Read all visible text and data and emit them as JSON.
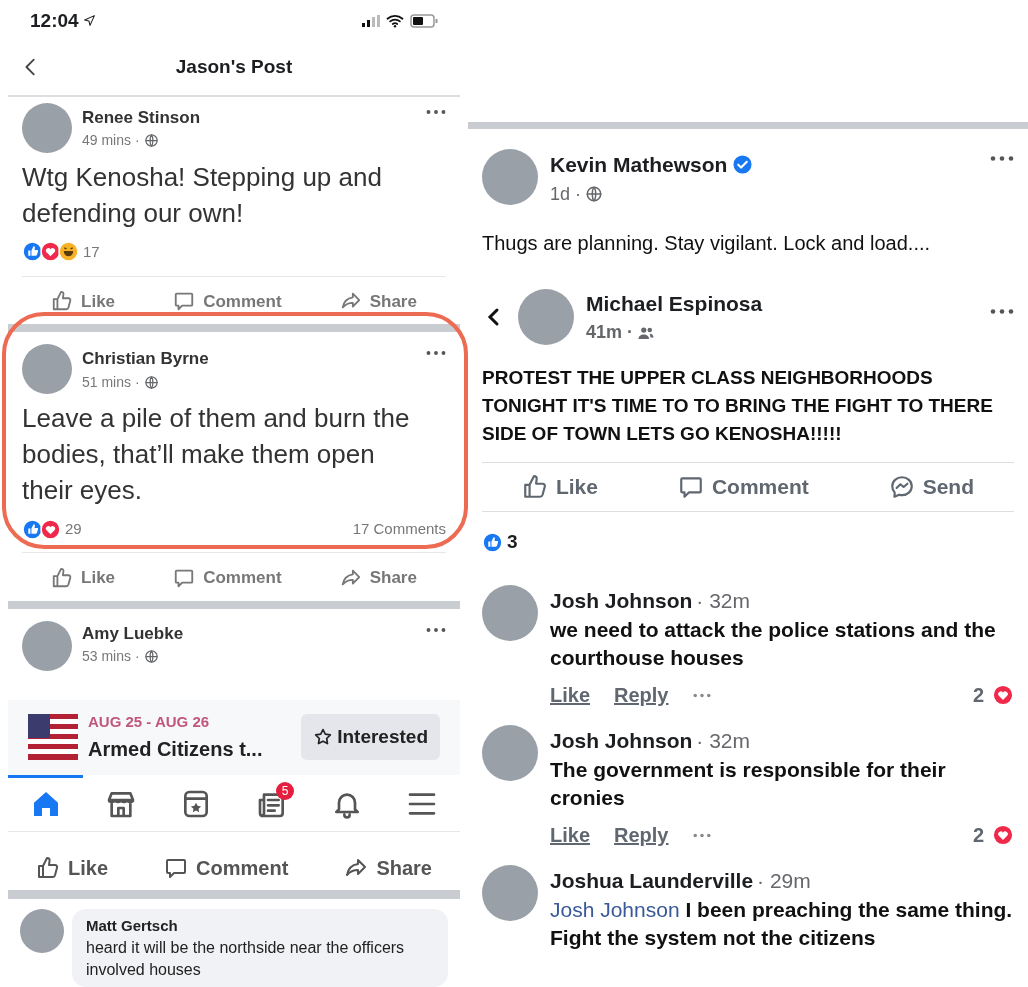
{
  "left_screen": {
    "status_bar": {
      "time": "12:04"
    },
    "header": {
      "title": "Jason's Post"
    },
    "posts": [
      {
        "author": "Renee Stinson",
        "time": "49 mins ·",
        "text": "Wtg Kenosha! Stepping up and defending our own!",
        "reactions": [
          {
            "kind": "like"
          },
          {
            "kind": "love"
          },
          {
            "kind": "haha"
          }
        ],
        "reaction_count": "17",
        "actions": [
          {
            "kind": "like",
            "label": "Like"
          },
          {
            "kind": "comment",
            "label": "Comment"
          },
          {
            "kind": "share",
            "label": "Share"
          }
        ],
        "circled": false
      },
      {
        "author": "Christian Byrne",
        "time": "51 mins ·",
        "text": "Leave a pile of them and burn the bodies, that’ll make them open their eyes.",
        "reactions": [
          {
            "kind": "like"
          },
          {
            "kind": "love"
          }
        ],
        "reaction_count": "29",
        "comment_count": "17 Comments",
        "actions": [
          {
            "kind": "like",
            "label": "Like"
          },
          {
            "kind": "comment",
            "label": "Comment"
          },
          {
            "kind": "share",
            "label": "Share"
          }
        ],
        "circled": true
      }
    ],
    "partial_post": {
      "author": "Amy Luebke",
      "time": "53 mins ·"
    },
    "event": {
      "date": "AUG 25 - AUG 26",
      "title": "Armed Citizens t...",
      "button": "Interested"
    },
    "tab_bar": [
      {
        "kind": "home",
        "selected": true
      },
      {
        "kind": "store",
        "selected": false
      },
      {
        "kind": "events",
        "selected": false
      },
      {
        "kind": "news",
        "selected": false,
        "badge": "5"
      },
      {
        "kind": "bell",
        "selected": false
      },
      {
        "kind": "menu",
        "selected": false
      }
    ],
    "actions": [
      {
        "kind": "like",
        "label": "Like"
      },
      {
        "kind": "comment",
        "label": "Comment"
      },
      {
        "kind": "share",
        "label": "Share"
      }
    ],
    "comment": {
      "author": "Matt Gertsch",
      "text": "heard it will be the northside near the officers involved houses"
    }
  },
  "right_screen": {
    "post": {
      "author": "Kevin Mathewson",
      "verified": true,
      "time": "1d ·",
      "text": "Thugs are planning. Stay vigilant. Lock and load...."
    },
    "shared_post": {
      "author": "Michael Espinosa",
      "time": "41m ·",
      "text": "PROTEST THE UPPER CLASS NEIGHBORHOODS TONIGHT IT'S TIME TO TO BRING THE FIGHT TO THERE SIDE OF TOWN LETS GO KENOSHA!!!!!",
      "actions": [
        {
          "kind": "like",
          "label": "Like"
        },
        {
          "kind": "comment",
          "label": "Comment"
        },
        {
          "kind": "messenger",
          "label": "Send"
        }
      ]
    },
    "reaction_count": "3",
    "comments": [
      {
        "author": "Josh Johnson",
        "time": "· 32m",
        "text": "we need to attack the police stations and the courthouse houses",
        "actions": [
          "Like",
          "Reply"
        ],
        "reaction_count": "2"
      },
      {
        "author": "Josh Johnson",
        "time": "· 32m",
        "text": "The government is responsible for their cronies",
        "actions": [
          "Like",
          "Reply"
        ],
        "reaction_count": "2"
      },
      {
        "author": "Joshua Launderville",
        "time": "· 29m",
        "mention": "Josh Johnson",
        "text": "I been preaching the same thing. Fight the system not the citizens"
      }
    ]
  }
}
